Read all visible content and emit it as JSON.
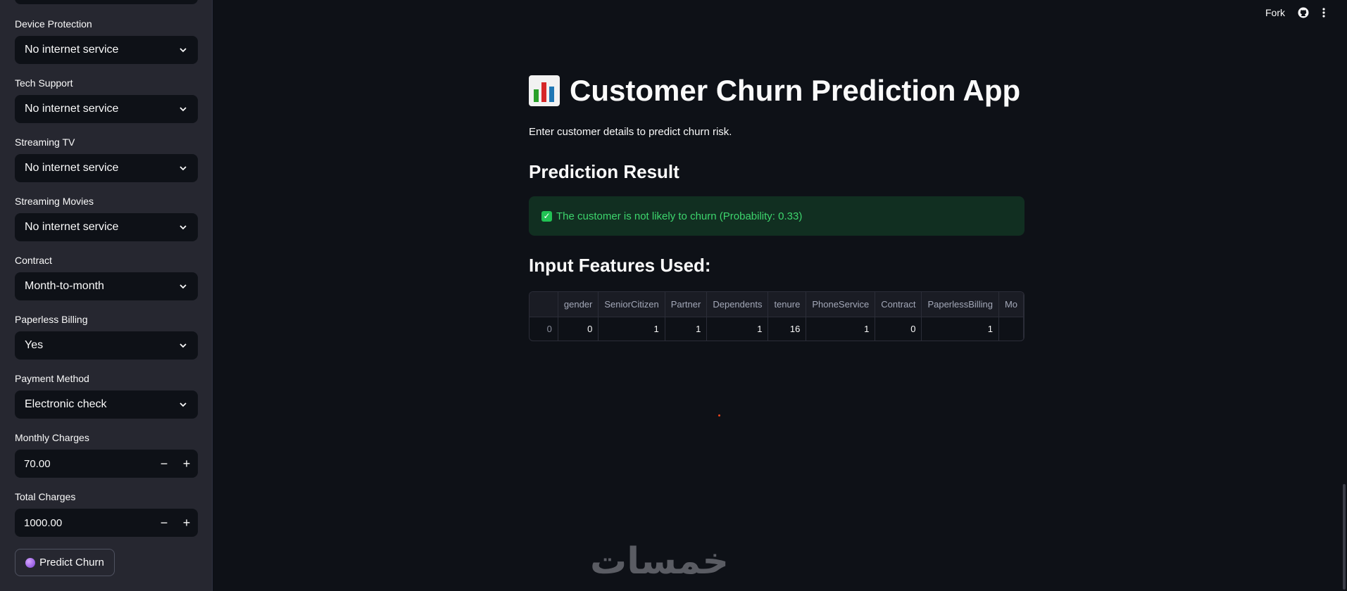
{
  "sidebar": {
    "fields": [
      {
        "label": "Device Protection",
        "value": "No internet service"
      },
      {
        "label": "Tech Support",
        "value": "No internet service"
      },
      {
        "label": "Streaming TV",
        "value": "No internet service"
      },
      {
        "label": "Streaming Movies",
        "value": "No internet service"
      },
      {
        "label": "Contract",
        "value": "Month-to-month"
      },
      {
        "label": "Paperless Billing",
        "value": "Yes"
      },
      {
        "label": "Payment Method",
        "value": "Electronic check"
      }
    ],
    "monthly_charges": {
      "label": "Monthly Charges",
      "value": "70.00",
      "minus": "−",
      "plus": "+"
    },
    "total_charges": {
      "label": "Total Charges",
      "value": "1000.00",
      "minus": "−",
      "plus": "+"
    },
    "predict_button": "Predict Churn"
  },
  "toolbar": {
    "fork": "Fork"
  },
  "main": {
    "title": "Customer Churn Prediction App",
    "subtitle": "Enter customer details to predict churn risk.",
    "result_heading": "Prediction Result",
    "result_message": "The customer is not likely to churn (Probability: 0.33)",
    "features_heading": "Input Features Used:",
    "table": {
      "columns": [
        "gender",
        "SeniorCitizen",
        "Partner",
        "Dependents",
        "tenure",
        "PhoneService",
        "Contract",
        "PaperlessBilling",
        "Mo"
      ],
      "rows": [
        {
          "index": "0",
          "values": [
            "0",
            "1",
            "1",
            "1",
            "16",
            "1",
            "0",
            "1",
            ""
          ]
        }
      ]
    }
  },
  "watermark": "خمسات",
  "colors": {
    "background": "#0e1117",
    "sidebar": "#262730",
    "success": "#3dd56d"
  }
}
